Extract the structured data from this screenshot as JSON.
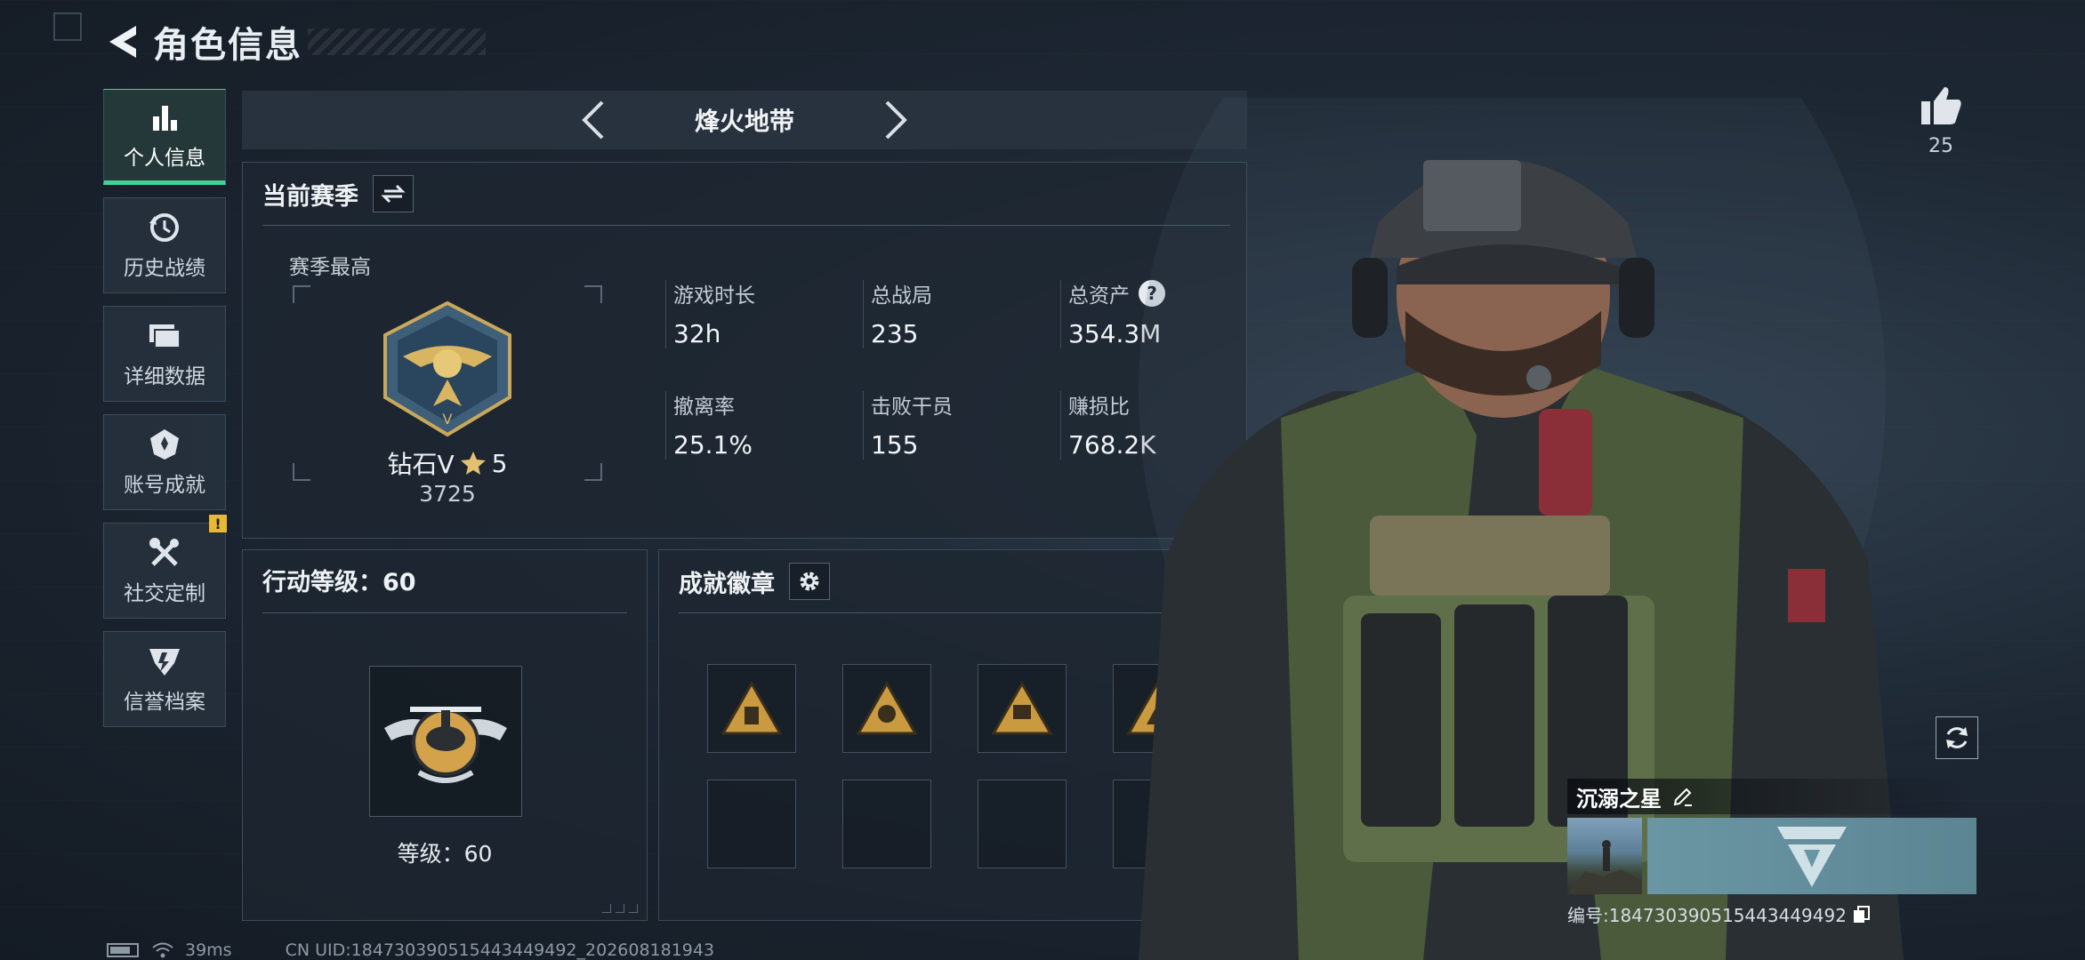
{
  "header": {
    "title": "角色信息"
  },
  "nav": {
    "items": [
      {
        "label": "个人信息",
        "icon": "bar-chart-icon",
        "active": true
      },
      {
        "label": "历史战绩",
        "icon": "history-clock-icon"
      },
      {
        "label": "详细数据",
        "icon": "folders-icon"
      },
      {
        "label": "账号成就",
        "icon": "achievement-medal-icon"
      },
      {
        "label": "社交定制",
        "icon": "tools-icon",
        "badge": "!"
      },
      {
        "label": "信誉档案",
        "icon": "credit-emblem-icon"
      }
    ]
  },
  "mode": {
    "title": "烽火地带"
  },
  "season": {
    "title": "当前赛季",
    "best_label": "赛季最高",
    "rank_name": "钻石V",
    "rank_stars": "5",
    "rank_score": "3725",
    "stats": [
      {
        "label": "游戏时长",
        "value": "32h"
      },
      {
        "label": "总战局",
        "value": "235"
      },
      {
        "label": "总资产",
        "value": "354.3M",
        "help": "?"
      },
      {
        "label": "撤离率",
        "value": "25.1%"
      },
      {
        "label": "击败干员",
        "value": "155"
      },
      {
        "label": "赚损比",
        "value": "768.2K"
      }
    ]
  },
  "level": {
    "title": "行动等级：60",
    "text": "等级：60"
  },
  "badges": {
    "title": "成就徽章",
    "icons": [
      "triangle-badge-icon",
      "triangle-badge-icon",
      "triangle-badge-icon",
      "triangle-badge-icon"
    ]
  },
  "likes": {
    "count": "25"
  },
  "card": {
    "name": "沉溺之星",
    "id_text": "编号:1847303905154434​49492"
  },
  "status": {
    "ping": "39ms",
    "uid": "CN UID:18473039051544344​9492_202608181943"
  },
  "colors": {
    "accent": "#3fd398",
    "warning": "#e9b936"
  }
}
